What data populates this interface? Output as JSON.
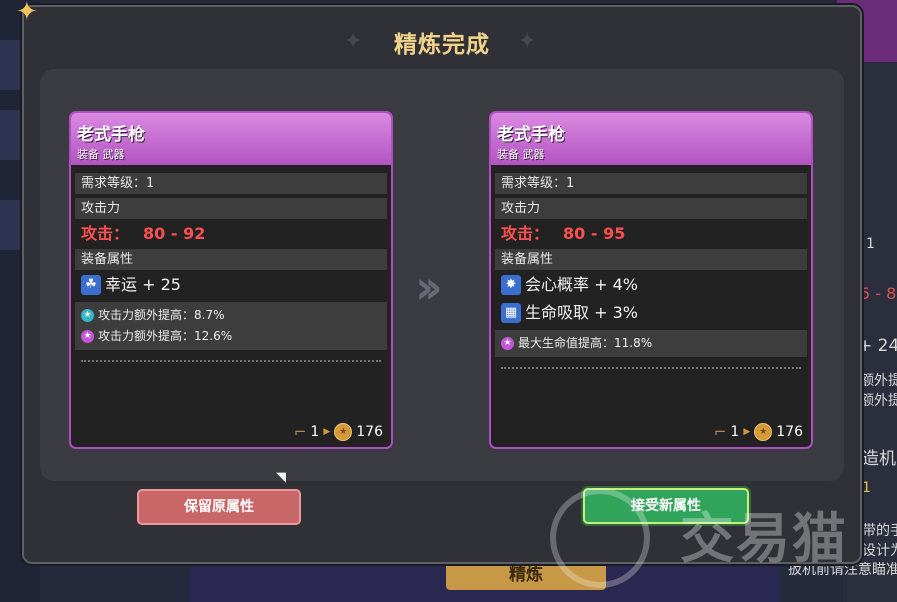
{
  "background": {
    "refine_button": "精炼",
    "side_texts": [
      "1",
      "5 - 8",
      "+ 24",
      "额外提",
      "额外提",
      "造机",
      "1",
      "带的手",
      "设计为",
      "扳机前请注意瞄准"
    ]
  },
  "modal": {
    "title": "精炼完成",
    "buttons": {
      "keep": "保留原属性",
      "accept": "接受新属性"
    }
  },
  "cards": [
    {
      "name": "老式手枪",
      "type": "装备 武器",
      "level_label": "需求等级：1",
      "attack_header": "攻击力",
      "attack_label": "攻击：",
      "attack_value": "80 - 92",
      "props_header": "装备属性",
      "stats": [
        {
          "icon": "luck-icon",
          "text": "幸运 + 25"
        }
      ],
      "bonuses": [
        {
          "icon": "cyan",
          "text": "攻击力额外提高：8.7%"
        },
        {
          "icon": "pink",
          "text": "攻击力额外提高：12.6%"
        }
      ],
      "cost": {
        "count": "1",
        "coins": "176"
      }
    },
    {
      "name": "老式手枪",
      "type": "装备 武器",
      "level_label": "需求等级：1",
      "attack_header": "攻击力",
      "attack_label": "攻击：",
      "attack_value": "80 - 95",
      "props_header": "装备属性",
      "stats": [
        {
          "icon": "crit-icon",
          "text": "会心概率 + 4%"
        },
        {
          "icon": "lifesteal-icon",
          "text": "生命吸取 + 3%"
        }
      ],
      "bonuses": [
        {
          "icon": "pink",
          "text": "最大生命值提高：11.8%"
        }
      ],
      "cost": {
        "count": "1",
        "coins": "176"
      }
    }
  ],
  "watermark": "交易猫",
  "colors": {
    "attack_red": "#ff4f4f",
    "rarity_purple": "#b354c2",
    "title_gold": "#f1d38a",
    "accept_green": "#2fa45a",
    "keep_red": "#c96668"
  }
}
